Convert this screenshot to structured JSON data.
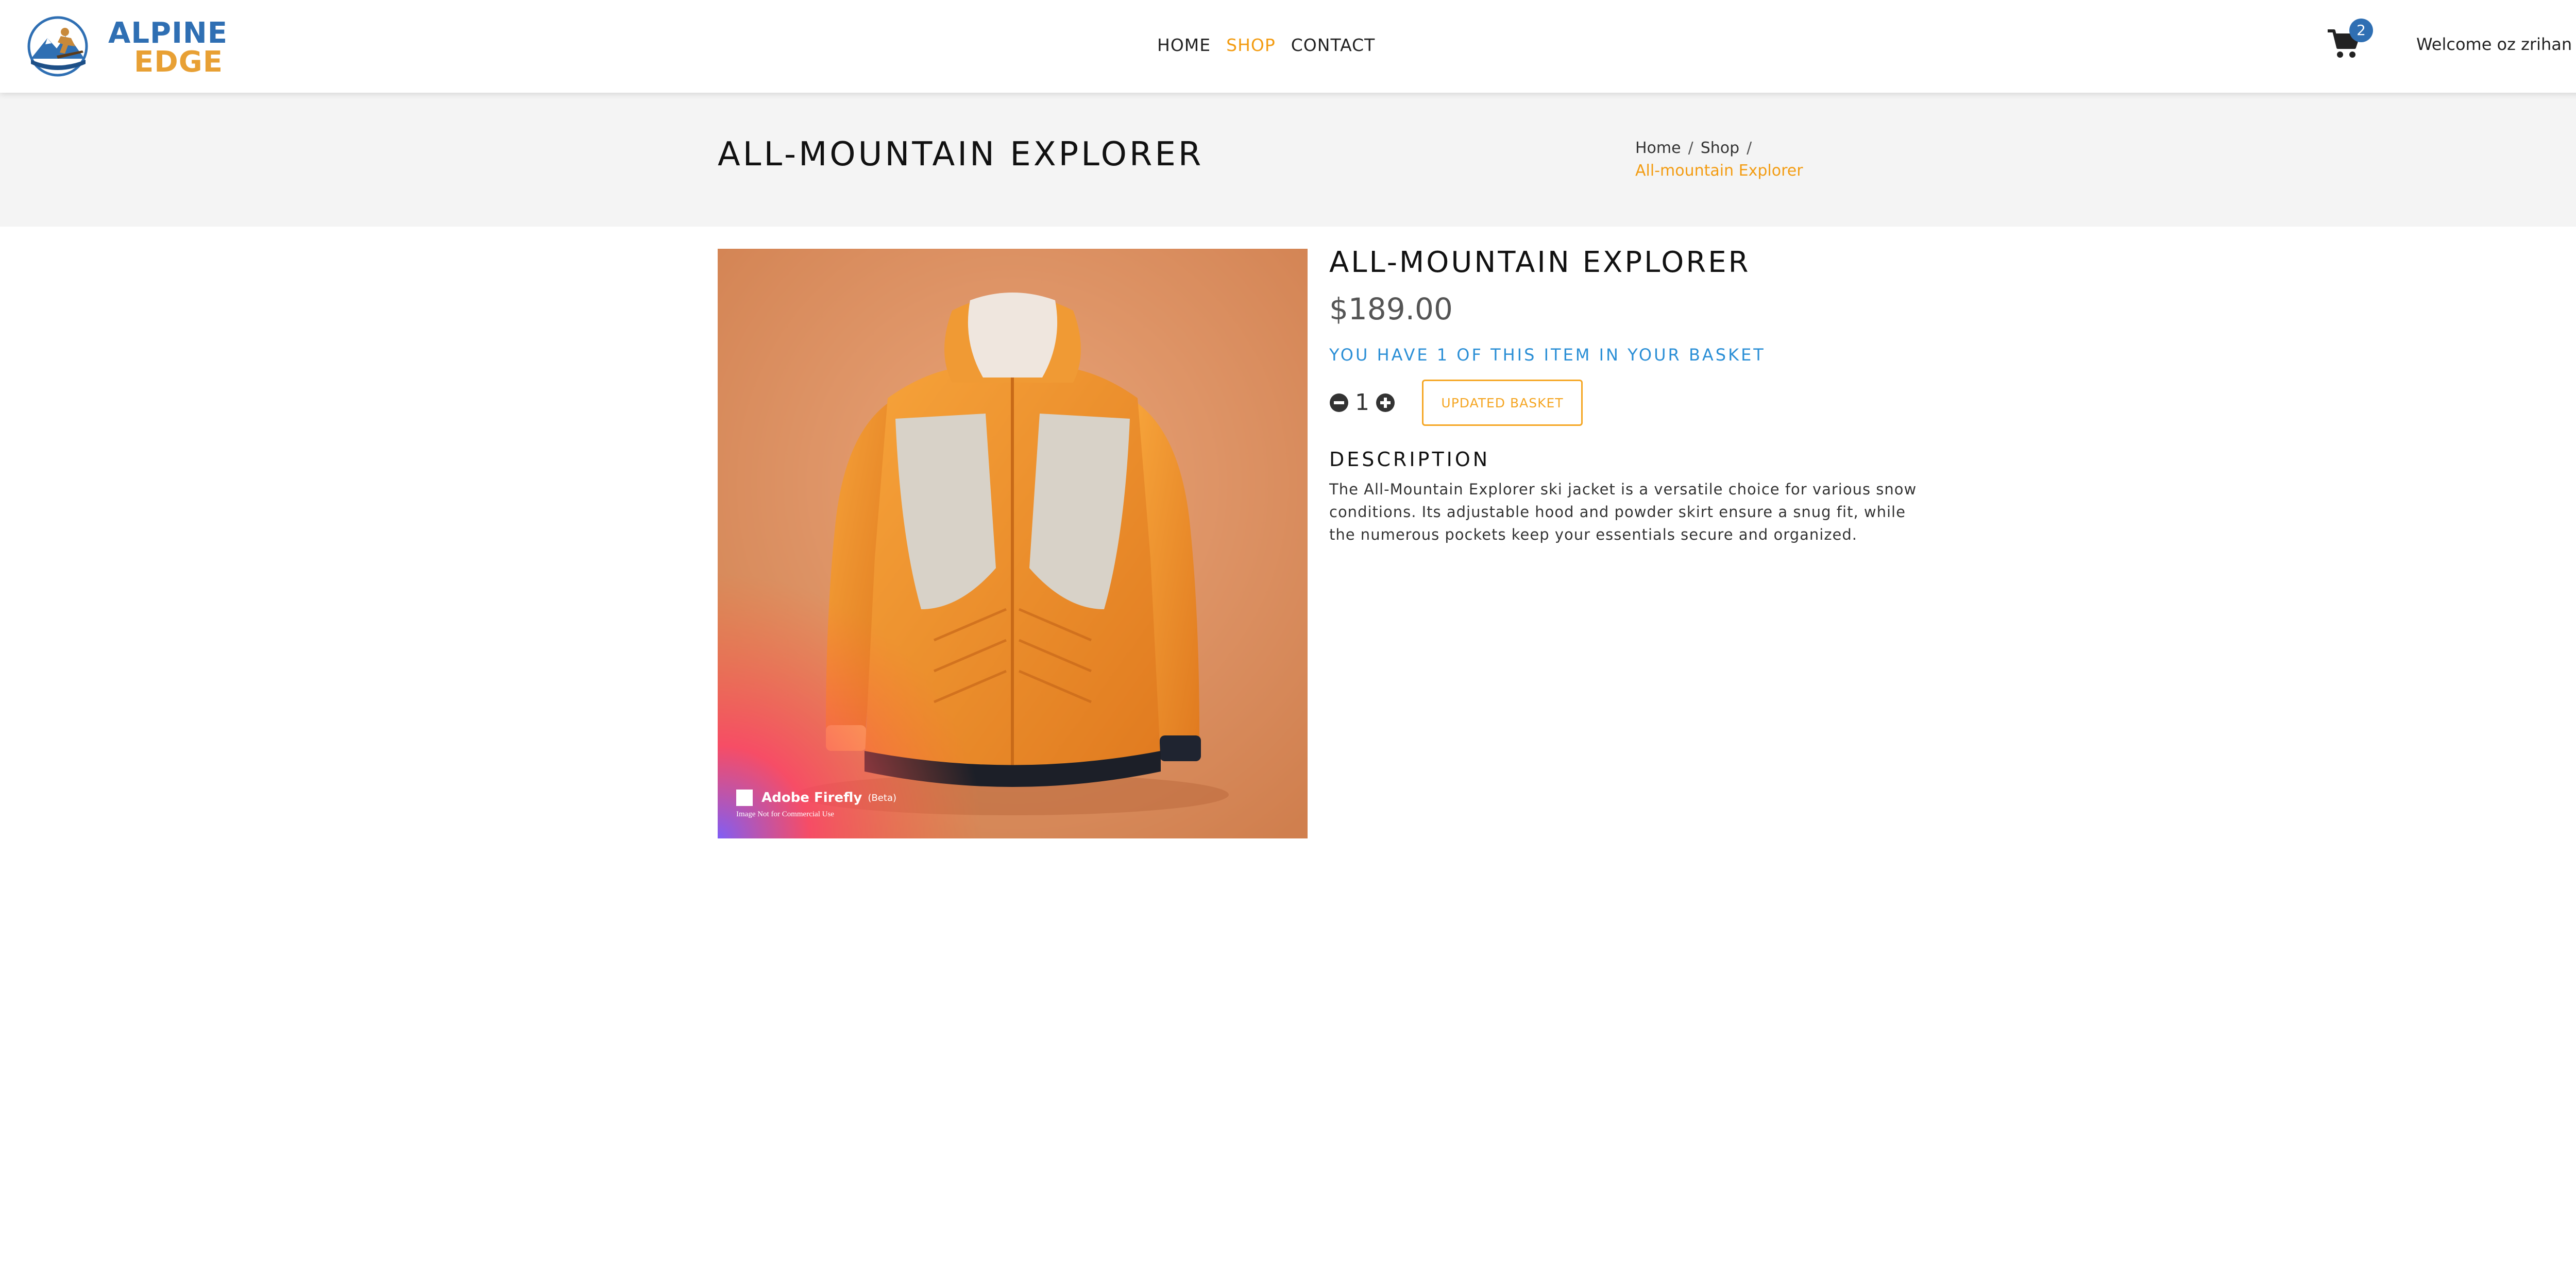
{
  "brand": {
    "name_top": "ALPINE",
    "name_bottom": "EDGE",
    "logo_icon": "mountain-skier-logo",
    "primary_color": "#2f6fb3",
    "accent_color": "#e8a034"
  },
  "nav": {
    "links": [
      {
        "label": "HOME",
        "active": false
      },
      {
        "label": "SHOP",
        "active": true
      },
      {
        "label": "CONTACT",
        "active": false
      }
    ],
    "cart_icon": "shopping-cart-icon",
    "cart_count": "2",
    "welcome": "Welcome oz zrihan"
  },
  "page_header": {
    "title": "ALL-MOUNTAIN EXPLORER",
    "breadcrumb": [
      "Home",
      "Shop"
    ],
    "breadcrumb_current": "All-mountain Explorer"
  },
  "product": {
    "title": "ALL-MOUNTAIN EXPLORER",
    "price": "$189.00",
    "basket_message": "YOU HAVE 1 OF THIS ITEM IN YOUR BASKET",
    "quantity": "1",
    "update_button": "UPDATED BASKET",
    "description_heading": "DESCRIPTION",
    "description": "The All-Mountain Explorer ski jacket is a versatile choice for various snow conditions. Its adjustable hood and powder skirt ensure a snug fit, while the numerous pockets keep your essentials secure and organized.",
    "image_watermark": "Adobe Firefly",
    "image_watermark_tag": "(Beta)",
    "image_watermark_note": "Image Not for Commercial Use"
  }
}
